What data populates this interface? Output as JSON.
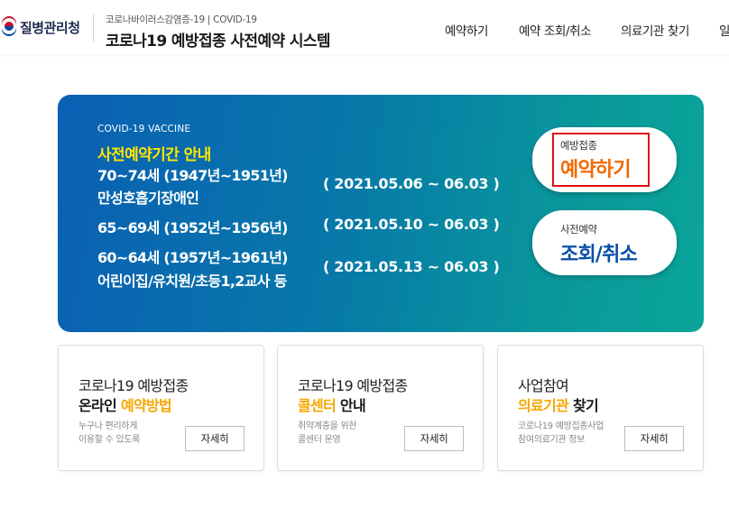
{
  "header": {
    "logo_text": "질병관리청",
    "subtitle": "코로나바이러스감염증-19 | COVID-19",
    "title": "코로나19 예방접종 사전예약 시스템",
    "nav": [
      "예약하기",
      "예약 조회/취소",
      "의료기관 찾기",
      "일"
    ]
  },
  "hero": {
    "eyebrow": "COVID-19 VACCINE",
    "heading": "사전예약기간 안내",
    "groups": [
      {
        "lines": [
          "70~74세 (1947년~1951년)",
          "만성호흡기장애인"
        ],
        "period": "( 2021.05.06 ~ 06.03 )"
      },
      {
        "lines": [
          "65~69세 (1952년~1956년)"
        ],
        "period": "( 2021.05.10 ~ 06.03 )"
      },
      {
        "lines": [
          "60~64세 (1957년~1961년)",
          "어린이집/유치원/초등1,2교사 등"
        ],
        "period": "( 2021.05.13 ~ 06.03 )"
      }
    ],
    "reserve_button": {
      "small": "예방접종",
      "big": "예약하기",
      "color": "#f26a00"
    },
    "lookup_button": {
      "small": "사전예약",
      "big": "조회/취소",
      "color": "#0a4ea8"
    }
  },
  "cards": [
    {
      "title": "코로나19 예방접종",
      "sub_plain": "온라인 ",
      "sub_accent": "예약방법",
      "accent_first": false,
      "desc": [
        "누구나 편리하게",
        "이용할 수 있도록"
      ],
      "button": "자세히"
    },
    {
      "title": "코로나19 예방접종",
      "sub_accent": "콜센터",
      "sub_plain": " 안내",
      "accent_first": true,
      "desc": [
        "취약계층을 위한",
        "콜센터 운영"
      ],
      "button": "자세히"
    },
    {
      "title": "사업참여",
      "sub_accent": "의료기관",
      "sub_plain": " 찾기",
      "accent_first": true,
      "desc": [
        "코로나19 예방접종사업",
        "참여의료기관 정보"
      ],
      "button": "자세히"
    }
  ],
  "colors": {
    "accent": "#f5a700",
    "hero_heading": "#ffe600",
    "highlight_box": "#e01010"
  }
}
